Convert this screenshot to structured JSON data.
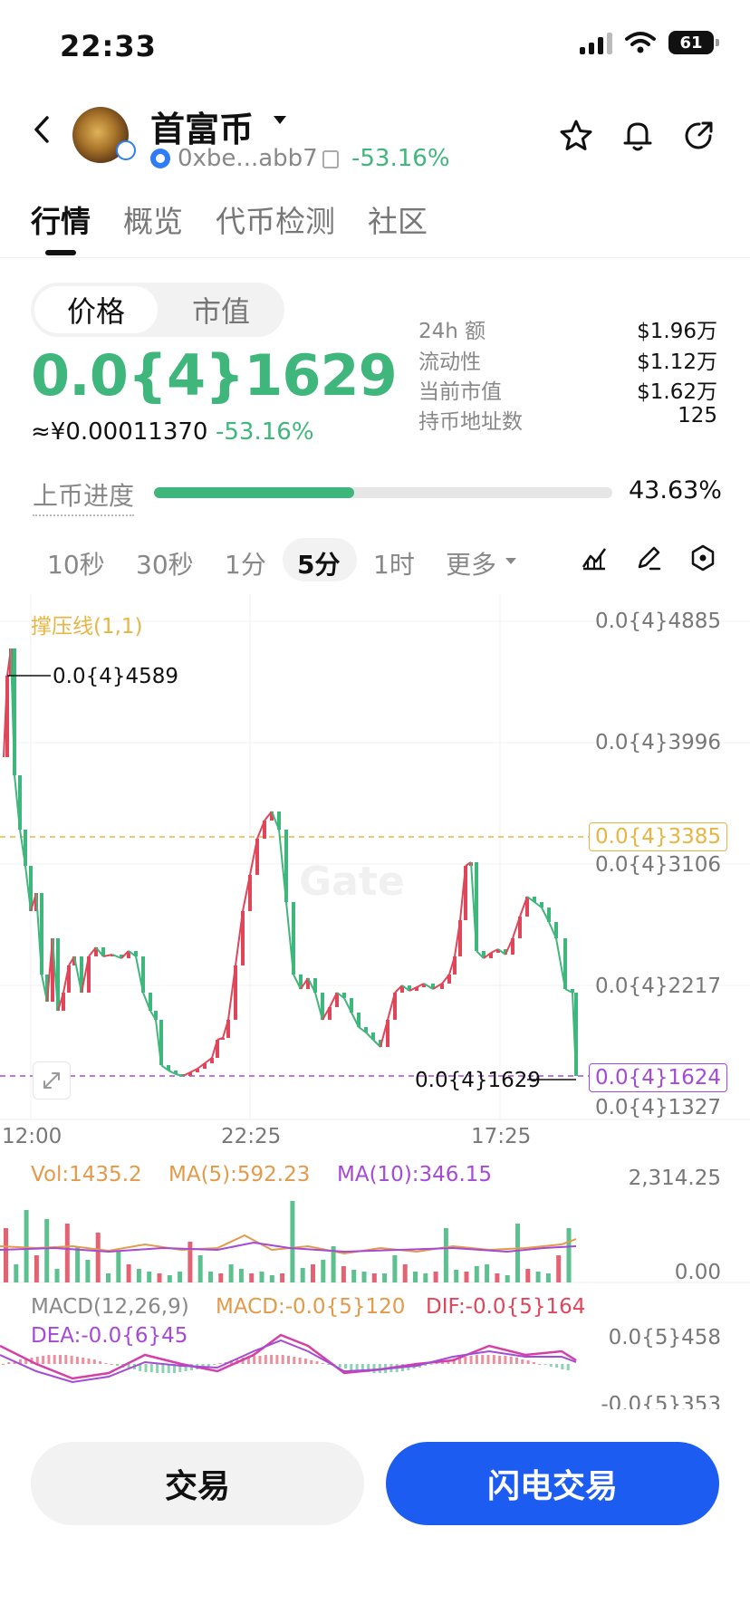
{
  "status_bar": {
    "time": "22:33",
    "battery": "61"
  },
  "header": {
    "token_name": "首富币",
    "address": "0xbe...abb7",
    "change": "-53.16%",
    "icons": [
      "back-icon",
      "star-icon",
      "bell-icon",
      "share-icon",
      "copy-icon",
      "chevron-down-icon"
    ]
  },
  "tabs": [
    {
      "label": "行情",
      "active": true
    },
    {
      "label": "概览"
    },
    {
      "label": "代币检测"
    },
    {
      "label": "社区"
    }
  ],
  "price_toggle": {
    "price": "价格",
    "market_cap": "市值"
  },
  "price": {
    "main": "0.0{4}1629",
    "cny": "≈¥0.00011370",
    "change": "-53.16%"
  },
  "stats": [
    {
      "label": "24h  额",
      "value": "$1.96万"
    },
    {
      "label": "流动性",
      "value": "$1.12万"
    },
    {
      "label": "当前市值",
      "value": "$1.62万"
    },
    {
      "label": "持币地址数",
      "value": "125"
    }
  ],
  "listing": {
    "label": "上币进度",
    "percent_text": "43.63%",
    "progress": 0.4363
  },
  "intervals": [
    {
      "label": "10秒"
    },
    {
      "label": "30秒"
    },
    {
      "label": "1分"
    },
    {
      "label": "5分",
      "active": true
    },
    {
      "label": "1时"
    },
    {
      "label": "更多"
    }
  ],
  "chart": {
    "indicator_label": "撑压线(1,1)",
    "watermark": "Gate",
    "price_axis": [
      "0.0{4}4885",
      "0.0{4}3996",
      "0.0{4}3106",
      "0.0{4}2217",
      "0.0{4}1327"
    ],
    "resistance_tag": "0.0{4}3385",
    "current_tag": "0.0{4}1624",
    "high_label": "0.0{4}4589",
    "low_label": "0.0{4}1629",
    "time_axis": [
      "12:00",
      "22:25",
      "17:25"
    ],
    "volume": {
      "vol": "Vol:1435.2",
      "ma5": "MA(5):592.23",
      "ma10": "MA(10):346.15",
      "axis_top": "2,314.25",
      "axis_bottom": "0.00"
    },
    "macd": {
      "title": "MACD(12,26,9)",
      "macd": "MACD:-0.0{5}120",
      "dif": "DIF:-0.0{5}164",
      "dea": "DEA:-0.0{6}45",
      "axis_top": "0.0{5}458",
      "axis_bottom": "-0.0{5}353"
    },
    "colors": {
      "up": "#3fb67b",
      "down": "#e0465a",
      "ma5": "#e39a4a",
      "ma10": "#a54ad6",
      "resistance": "#e8b542",
      "support": "#a54ad6"
    }
  },
  "actions": {
    "trade": "交易",
    "flash_trade": "闪电交易"
  }
}
